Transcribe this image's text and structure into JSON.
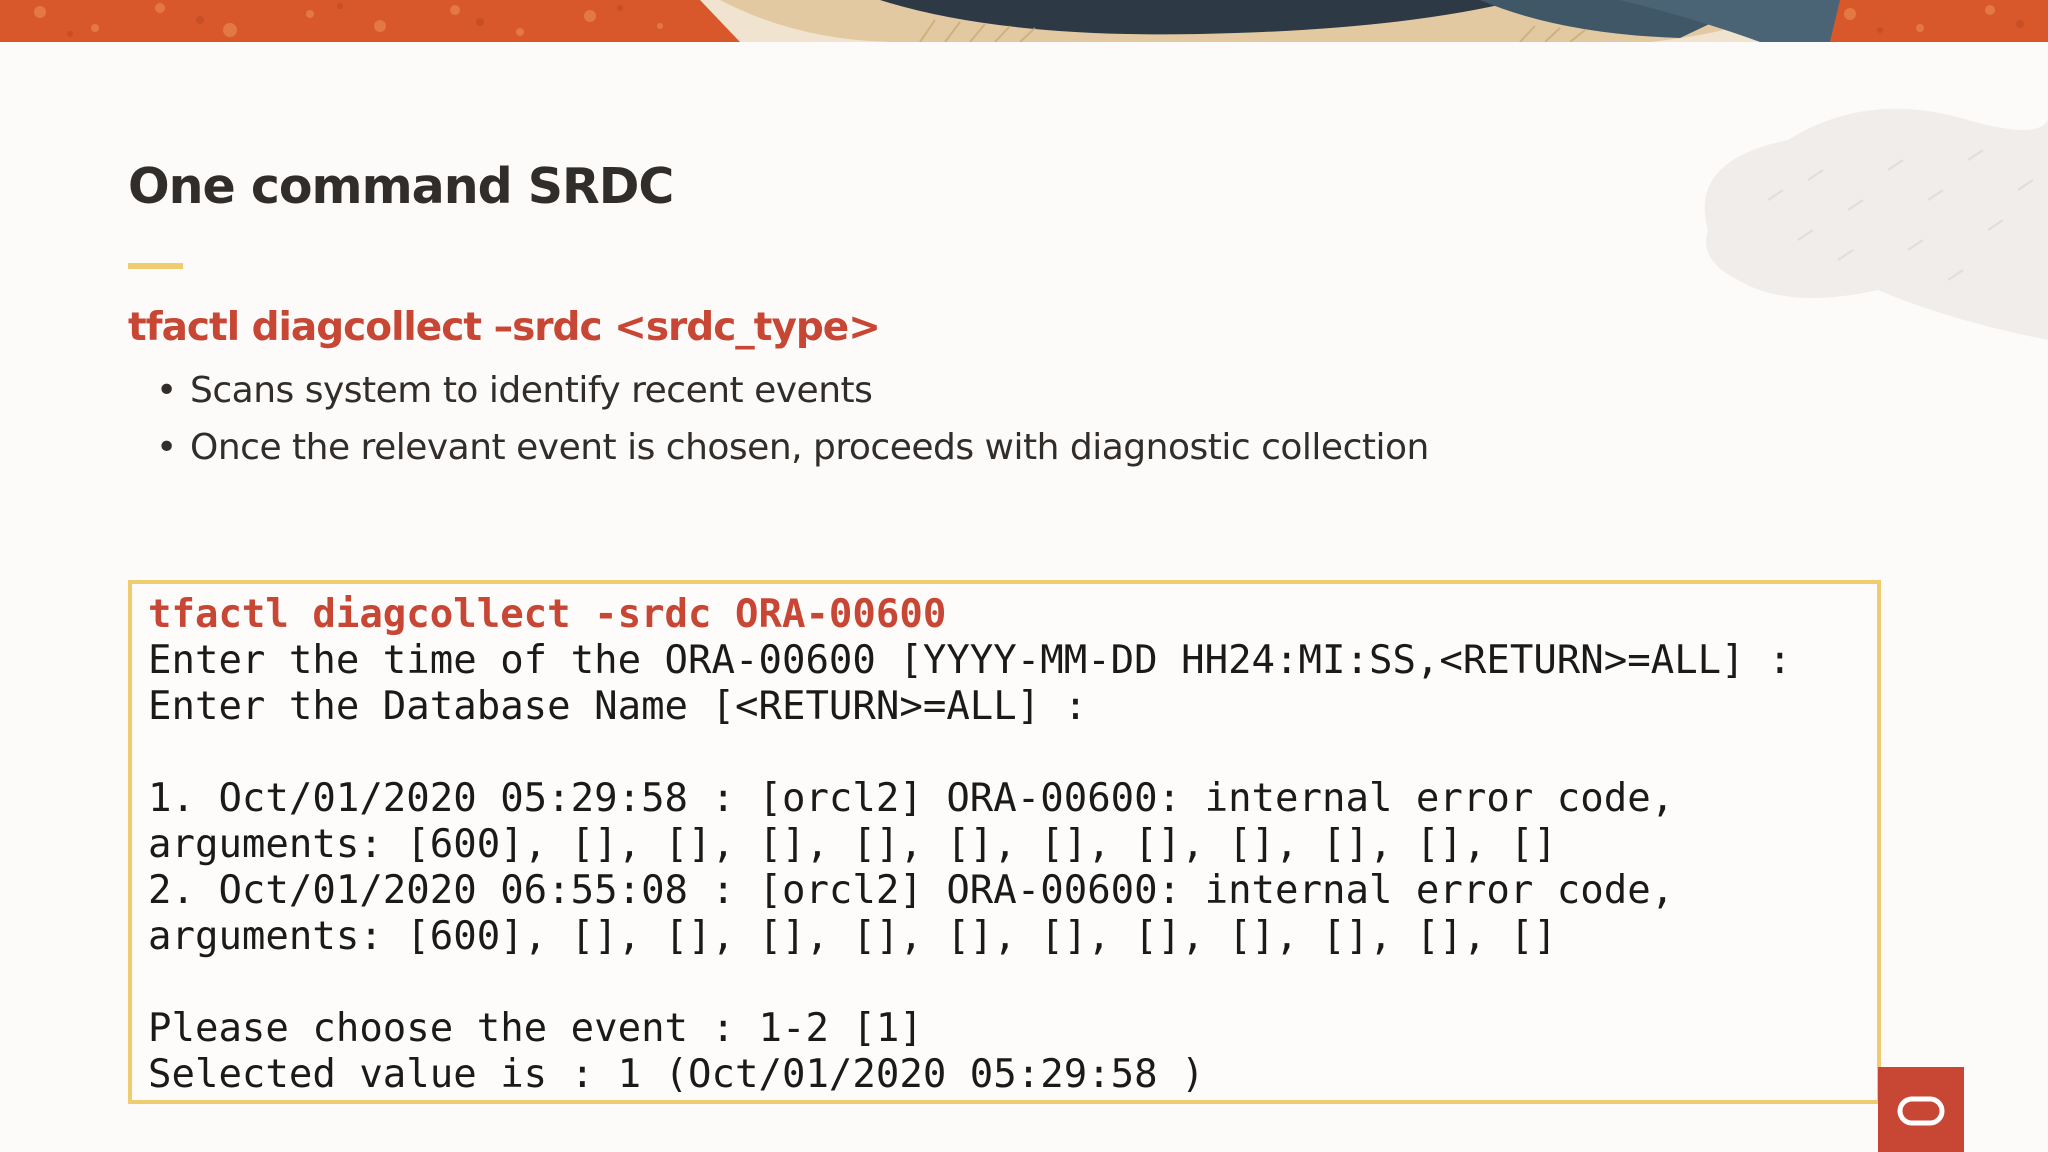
{
  "slide": {
    "title": "One command SRDC",
    "command_heading": "tfactl diagcollect –srdc <srdc_type>",
    "bullets": [
      "Scans system to identify recent events",
      "Once the relevant event is chosen, proceeds with diagnostic collection"
    ],
    "bullet_glyph": "•"
  },
  "terminal": {
    "command": "tfactl diagcollect -srdc ORA-00600",
    "lines": [
      "Enter the time of the ORA-00600 [YYYY-MM-DD HH24:MI:SS,<RETURN>=ALL] :",
      "Enter the Database Name [<RETURN>=ALL] :",
      "",
      "1. Oct/01/2020 05:29:58 : [orcl2] ORA-00600: internal error code,",
      "arguments: [600], [], [], [], [], [], [], [], [], [], [], []",
      "2. Oct/01/2020 06:55:08 : [orcl2] ORA-00600: internal error code,",
      "arguments: [600], [], [], [], [], [], [], [], [], [], [], []",
      "",
      "Please choose the event : 1-2 [1]",
      "Selected value is : 1 (Oct/01/2020 05:29:58 )"
    ]
  },
  "colors": {
    "accent_red": "#c74634",
    "rule_yellow": "#f0cc71",
    "text_dark": "#312d2a",
    "banner_orange": "#d9582b"
  },
  "icons": {
    "logo": "oracle-logo-icon"
  }
}
